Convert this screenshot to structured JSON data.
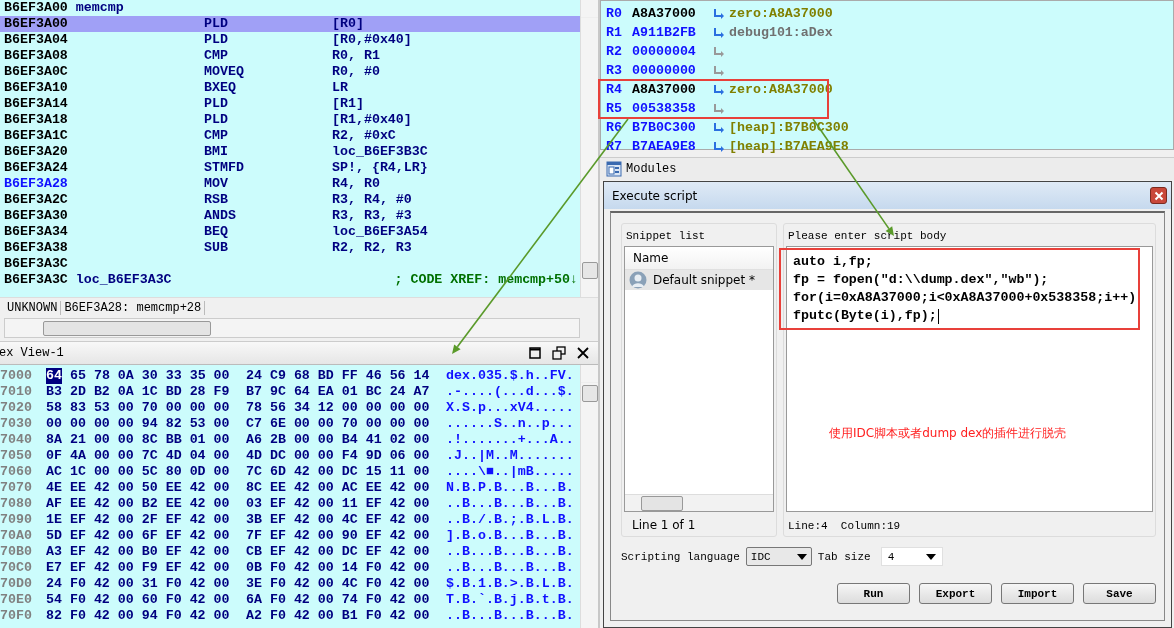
{
  "disassembly": {
    "rows": [
      {
        "kind": "label",
        "address": "B6EF3A00",
        "label": "memcmp",
        "selected": false,
        "current": false
      },
      {
        "kind": "instruction",
        "address": "B6EF3A00",
        "mnemonic": "PLD",
        "operands": "[R0]",
        "selected": true,
        "current": false
      },
      {
        "kind": "instruction",
        "address": "B6EF3A04",
        "mnemonic": "PLD",
        "operands": "[R0,#0x40]",
        "selected": false,
        "current": false
      },
      {
        "kind": "instruction",
        "address": "B6EF3A08",
        "mnemonic": "CMP",
        "operands": "R0, R1",
        "selected": false,
        "current": false
      },
      {
        "kind": "instruction",
        "address": "B6EF3A0C",
        "mnemonic": "MOVEQ",
        "operands": "R0, #0",
        "selected": false,
        "current": false
      },
      {
        "kind": "instruction",
        "address": "B6EF3A10",
        "mnemonic": "BXEQ",
        "operands": "LR",
        "selected": false,
        "current": false
      },
      {
        "kind": "instruction",
        "address": "B6EF3A14",
        "mnemonic": "PLD",
        "operands": "[R1]",
        "selected": false,
        "current": false
      },
      {
        "kind": "instruction",
        "address": "B6EF3A18",
        "mnemonic": "PLD",
        "operands": "[R1,#0x40]",
        "selected": false,
        "current": false
      },
      {
        "kind": "instruction",
        "address": "B6EF3A1C",
        "mnemonic": "CMP",
        "operands": "R2, #0xC",
        "selected": false,
        "current": false
      },
      {
        "kind": "instruction",
        "address": "B6EF3A20",
        "mnemonic": "BMI",
        "operands": "loc_B6EF3B3C",
        "selected": false,
        "current": false
      },
      {
        "kind": "instruction",
        "address": "B6EF3A24",
        "mnemonic": "STMFD",
        "operands": "SP!, {R4,LR}",
        "selected": false,
        "current": false
      },
      {
        "kind": "instruction",
        "address": "B6EF3A28",
        "mnemonic": "MOV",
        "operands": "R4, R0",
        "selected": false,
        "current": true
      },
      {
        "kind": "instruction",
        "address": "B6EF3A2C",
        "mnemonic": "RSB",
        "operands": "R3, R4, #0",
        "selected": false,
        "current": false
      },
      {
        "kind": "instruction",
        "address": "B6EF3A30",
        "mnemonic": "ANDS",
        "operands": "R3, R3, #3",
        "selected": false,
        "current": false
      },
      {
        "kind": "instruction",
        "address": "B6EF3A34",
        "mnemonic": "BEQ",
        "operands": "loc_B6EF3A54",
        "selected": false,
        "current": false
      },
      {
        "kind": "instruction",
        "address": "B6EF3A38",
        "mnemonic": "SUB",
        "operands": "R2, R2, R3",
        "selected": false,
        "current": false
      },
      {
        "kind": "address",
        "address": "B6EF3A3C",
        "selected": false,
        "current": false
      },
      {
        "kind": "label",
        "address": "B6EF3A3C",
        "label": "loc_B6EF3A3C",
        "comment": "; CODE XREF: memcmp+50↓",
        "selected": false,
        "current": false
      }
    ],
    "status": [
      "UNKNOWN",
      "B6EF3A28: memcmp+28"
    ]
  },
  "hex_view": {
    "title": "ex View-1",
    "rows": [
      {
        "address": "7000",
        "bytes": [
          "64 65 78 0A 30 33 35 00",
          "24 C9 68 BD FF 46 56 14"
        ],
        "ascii": "dex.035.$.h..FV.",
        "cursor_on_first": true
      },
      {
        "address": "7010",
        "bytes": [
          "B3 2D B2 0A 1C BD 28 F9",
          "B7 9C 64 EA 01 BC 24 A7"
        ],
        "ascii": ".-....(...d...$.",
        "cursor_on_first": false
      },
      {
        "address": "7020",
        "bytes": [
          "58 83 53 00 70 00 00 00",
          "78 56 34 12 00 00 00 00"
        ],
        "ascii": "X.S.p...xV4.....",
        "cursor_on_first": false
      },
      {
        "address": "7030",
        "bytes": [
          "00 00 00 00 94 82 53 00",
          "C7 6E 00 00 70 00 00 00"
        ],
        "ascii": "......S..n..p...",
        "cursor_on_first": false
      },
      {
        "address": "7040",
        "bytes": [
          "8A 21 00 00 8C BB 01 00",
          "A6 2B 00 00 B4 41 02 00"
        ],
        "ascii": ".!.......+...A..",
        "cursor_on_first": false
      },
      {
        "address": "7050",
        "bytes": [
          "0F 4A 00 00 7C 4D 04 00",
          "4D DC 00 00 F4 9D 06 00"
        ],
        "ascii": ".J..|M..M.......",
        "cursor_on_first": false
      },
      {
        "address": "7060",
        "bytes": [
          "AC 1C 00 00 5C 80 0D 00",
          "7C 6D 42 00 DC 15 11 00"
        ],
        "ascii": "....\\■..|mB.....",
        "cursor_on_first": false
      },
      {
        "address": "7070",
        "bytes": [
          "4E EE 42 00 50 EE 42 00",
          "8C EE 42 00 AC EE 42 00"
        ],
        "ascii": "N.B.P.B...B...B.",
        "cursor_on_first": false
      },
      {
        "address": "7080",
        "bytes": [
          "AF EE 42 00 B2 EE 42 00",
          "03 EF 42 00 11 EF 42 00"
        ],
        "ascii": "..B...B...B...B.",
        "cursor_on_first": false
      },
      {
        "address": "7090",
        "bytes": [
          "1E EF 42 00 2F EF 42 00",
          "3B EF 42 00 4C EF 42 00"
        ],
        "ascii": "..B./.B.;.B.L.B.",
        "cursor_on_first": false
      },
      {
        "address": "70A0",
        "bytes": [
          "5D EF 42 00 6F EF 42 00",
          "7F EF 42 00 90 EF 42 00"
        ],
        "ascii": "].B.o.B...B...B.",
        "cursor_on_first": false
      },
      {
        "address": "70B0",
        "bytes": [
          "A3 EF 42 00 B0 EF 42 00",
          "CB EF 42 00 DC EF 42 00"
        ],
        "ascii": "..B...B...B...B.",
        "cursor_on_first": false
      },
      {
        "address": "70C0",
        "bytes": [
          "E7 EF 42 00 F9 EF 42 00",
          "0B F0 42 00 14 F0 42 00"
        ],
        "ascii": "..B...B...B...B.",
        "cursor_on_first": false
      },
      {
        "address": "70D0",
        "bytes": [
          "24 F0 42 00 31 F0 42 00",
          "3E F0 42 00 4C F0 42 00"
        ],
        "ascii": "$.B.1.B.>.B.L.B.",
        "cursor_on_first": false
      },
      {
        "address": "70E0",
        "bytes": [
          "54 F0 42 00 60 F0 42 00",
          "6A F0 42 00 74 F0 42 00"
        ],
        "ascii": "T.B.`.B.j.B.t.B.",
        "cursor_on_first": false
      },
      {
        "address": "70F0",
        "bytes": [
          "82 F0 42 00 94 F0 42 00",
          "A2 F0 42 00 B1 F0 42 00"
        ],
        "ascii": "..B...B...B...B.",
        "cursor_on_first": false
      }
    ]
  },
  "registers": [
    {
      "name": "R0",
      "value": "A8A37000",
      "changed": false,
      "target": "zero:A8A37000",
      "color": "#808000",
      "annotated": false
    },
    {
      "name": "R1",
      "value": "A911B2FB",
      "changed": true,
      "target": "debug101:aDex",
      "color": "#707070",
      "annotated": false
    },
    {
      "name": "R2",
      "value": "00000004",
      "changed": true,
      "annotated": false
    },
    {
      "name": "R3",
      "value": "00000000",
      "changed": true,
      "annotated": false
    },
    {
      "name": "R4",
      "value": "A8A37000",
      "changed": false,
      "target": "zero:A8A37000",
      "color": "#808000",
      "annotated": true
    },
    {
      "name": "R5",
      "value": "00538358",
      "changed": true,
      "annotated": true
    },
    {
      "name": "R6",
      "value": "B7B0C300",
      "changed": true,
      "target": "[heap]:B7B0C300",
      "color": "#808000",
      "annotated": false
    },
    {
      "name": "R7",
      "value": "B7AEA9E8",
      "changed": true,
      "target": "[heap]:B7AEA9E8",
      "color": "#808000",
      "annotated": false
    }
  ],
  "modules_panel": {
    "title": "Modules"
  },
  "dialog": {
    "title": "Execute script",
    "snippet_list": {
      "label": "Snippet list",
      "column": "Name",
      "items": [
        {
          "name": "Default snippet *",
          "selected": true
        }
      ],
      "status": "Line 1 of 1"
    },
    "script": {
      "label": "Please enter script body",
      "lines": [
        "auto i,fp;",
        "fp = fopen(\"d:\\\\dump.dex\",\"wb\");",
        "for(i=0xA8A37000;i<0xA8A37000+0x538358;i++)",
        "fputc(Byte(i),fp);"
      ],
      "annotated": true,
      "note": "使用IDC脚本或者dump dex的插件进行脱壳",
      "status": "Line:4  Column:19"
    },
    "scripting_language": {
      "label": "Scripting language",
      "value": "IDC"
    },
    "tab_size": {
      "label": "Tab size",
      "value": "4"
    },
    "buttons": [
      "Run",
      "Export",
      "Import",
      "Save"
    ]
  }
}
